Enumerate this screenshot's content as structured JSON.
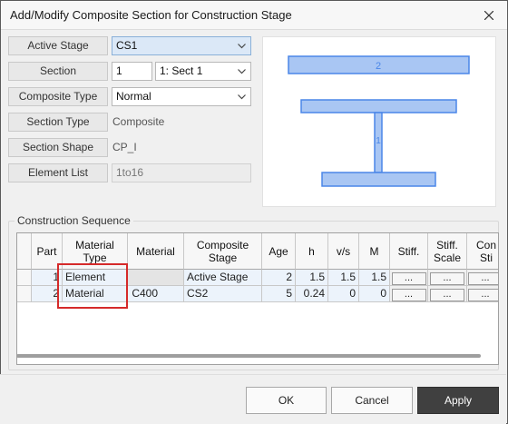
{
  "window": {
    "title": "Add/Modify Composite Section for Construction Stage"
  },
  "form": {
    "active_stage": {
      "label": "Active Stage",
      "value": "CS1"
    },
    "section": {
      "label": "Section",
      "number": "1",
      "value": "1: Sect 1"
    },
    "composite_type": {
      "label": "Composite Type",
      "value": "Normal"
    },
    "section_type": {
      "label": "Section Type",
      "value": "Composite"
    },
    "section_shape": {
      "label": "Section Shape",
      "value": "CP_I"
    },
    "element_list": {
      "label": "Element List",
      "value": "1to16"
    }
  },
  "preview": {
    "part1_label": "1",
    "part2_label": "2",
    "part_color": "#a9c6f3",
    "part_edge": "#4a86e8"
  },
  "construction_sequence": {
    "title": "Construction Sequence",
    "columns": [
      "Part",
      "Material Type",
      "Material",
      "Composite Stage",
      "Age",
      "h",
      "v/s",
      "M",
      "Stiff.",
      "Stiff. Scale",
      "Con Sti"
    ],
    "rows": [
      {
        "part": "1",
        "material_type": "Element",
        "material": "",
        "composite_stage": "Active Stage",
        "age": "2",
        "h": "1.5",
        "vs": "1.5",
        "m": "1.5",
        "stiff": "...",
        "stiff_scale": "...",
        "con": "..."
      },
      {
        "part": "2",
        "material_type": "Material",
        "material": "3: C400",
        "composite_stage": "CS2",
        "age": "5",
        "h": "0.24",
        "vs": "0",
        "m": "0",
        "stiff": "...",
        "stiff_scale": "...",
        "con": "..."
      }
    ]
  },
  "buttons": {
    "ok": "OK",
    "cancel": "Cancel",
    "apply": "Apply"
  },
  "colors": {
    "selection": "#dbe8f7",
    "highlight": "#d52a2a",
    "apply_bg": "#404040"
  }
}
